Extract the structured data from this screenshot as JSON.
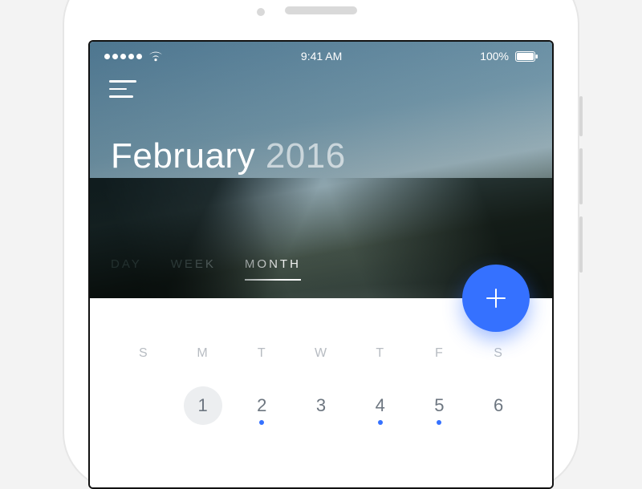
{
  "status": {
    "carrier_dots": 5,
    "time": "9:41 AM",
    "battery_pct": "100%"
  },
  "header": {
    "month": "February",
    "year": "2016"
  },
  "tabs": {
    "day": "DAY",
    "week": "WEEK",
    "month": "MONTH",
    "active": "month"
  },
  "calendar": {
    "dow": [
      "S",
      "M",
      "T",
      "W",
      "T",
      "F",
      "S"
    ],
    "week": [
      {
        "label": "",
        "has_dot": false,
        "today": false
      },
      {
        "label": "1",
        "has_dot": false,
        "today": true
      },
      {
        "label": "2",
        "has_dot": true,
        "today": false
      },
      {
        "label": "3",
        "has_dot": false,
        "today": false
      },
      {
        "label": "4",
        "has_dot": true,
        "today": false
      },
      {
        "label": "5",
        "has_dot": true,
        "today": false
      },
      {
        "label": "6",
        "has_dot": false,
        "today": false
      }
    ]
  },
  "colors": {
    "accent": "#3571ff"
  }
}
